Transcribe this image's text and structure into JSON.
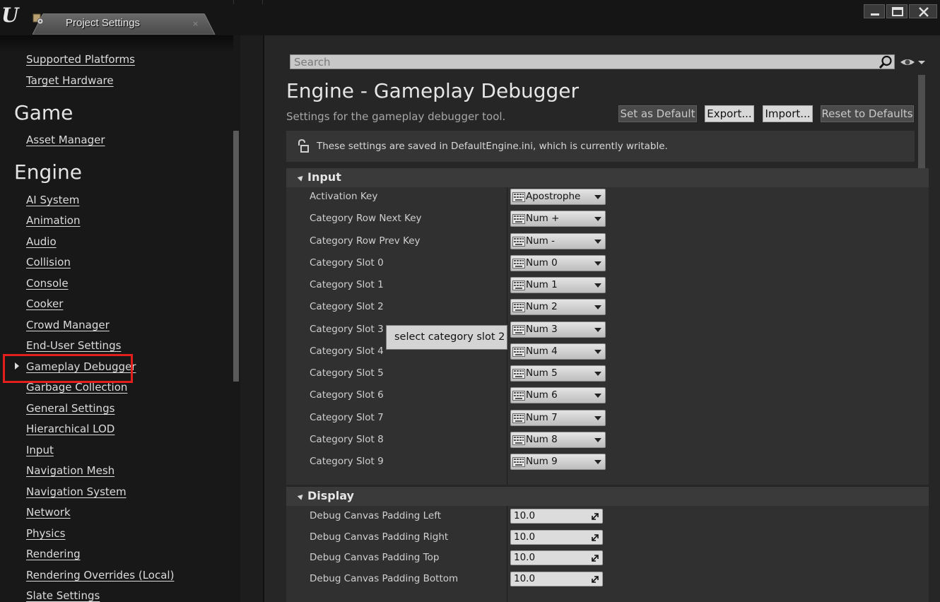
{
  "window": {
    "tab_label": "Project Settings",
    "tab_close": "×"
  },
  "sidebar": {
    "top_links": [
      "Supported Platforms",
      "Target Hardware"
    ],
    "game_heading": "Game",
    "game_links": [
      "Asset Manager"
    ],
    "engine_heading": "Engine",
    "engine_links": [
      "AI System",
      "Animation",
      "Audio",
      "Collision",
      "Console",
      "Cooker",
      "Crowd Manager",
      "End-User Settings",
      "Gameplay Debugger",
      "Garbage Collection",
      "General Settings",
      "Hierarchical LOD",
      "Input",
      "Navigation Mesh",
      "Navigation System",
      "Network",
      "Physics",
      "Rendering",
      "Rendering Overrides (Local)",
      "Slate Settings"
    ],
    "selected": "Gameplay Debugger"
  },
  "search": {
    "placeholder": "Search"
  },
  "header": {
    "title": "Engine - Gameplay Debugger",
    "subtitle": "Settings for the gameplay debugger tool.",
    "buttons": {
      "set_default": "Set as Default",
      "export": "Export...",
      "import": "Import...",
      "reset": "Reset to Defaults"
    },
    "info": "These settings are saved in DefaultEngine.ini, which is currently writable."
  },
  "input_section": {
    "title": "Input",
    "rows": [
      {
        "label": "Activation Key",
        "value": "Apostrophe"
      },
      {
        "label": "Category Row Next Key",
        "value": "Num +"
      },
      {
        "label": "Category Row Prev Key",
        "value": "Num -"
      },
      {
        "label": "Category Slot 0",
        "value": "Num 0"
      },
      {
        "label": "Category Slot 1",
        "value": "Num 1"
      },
      {
        "label": "Category Slot 2",
        "value": "Num 2"
      },
      {
        "label": "Category Slot 3",
        "value": "Num 3"
      },
      {
        "label": "Category Slot 4",
        "value": "Num 4"
      },
      {
        "label": "Category Slot 5",
        "value": "Num 5"
      },
      {
        "label": "Category Slot 6",
        "value": "Num 6"
      },
      {
        "label": "Category Slot 7",
        "value": "Num 7"
      },
      {
        "label": "Category Slot 8",
        "value": "Num 8"
      },
      {
        "label": "Category Slot 9",
        "value": "Num 9"
      }
    ]
  },
  "tooltip": "select category slot 2",
  "display_section": {
    "title": "Display",
    "rows": [
      {
        "label": "Debug Canvas Padding Left",
        "value": "10.0"
      },
      {
        "label": "Debug Canvas Padding Right",
        "value": "10.0"
      },
      {
        "label": "Debug Canvas Padding Top",
        "value": "10.0"
      },
      {
        "label": "Debug Canvas Padding Bottom",
        "value": "10.0"
      }
    ]
  }
}
